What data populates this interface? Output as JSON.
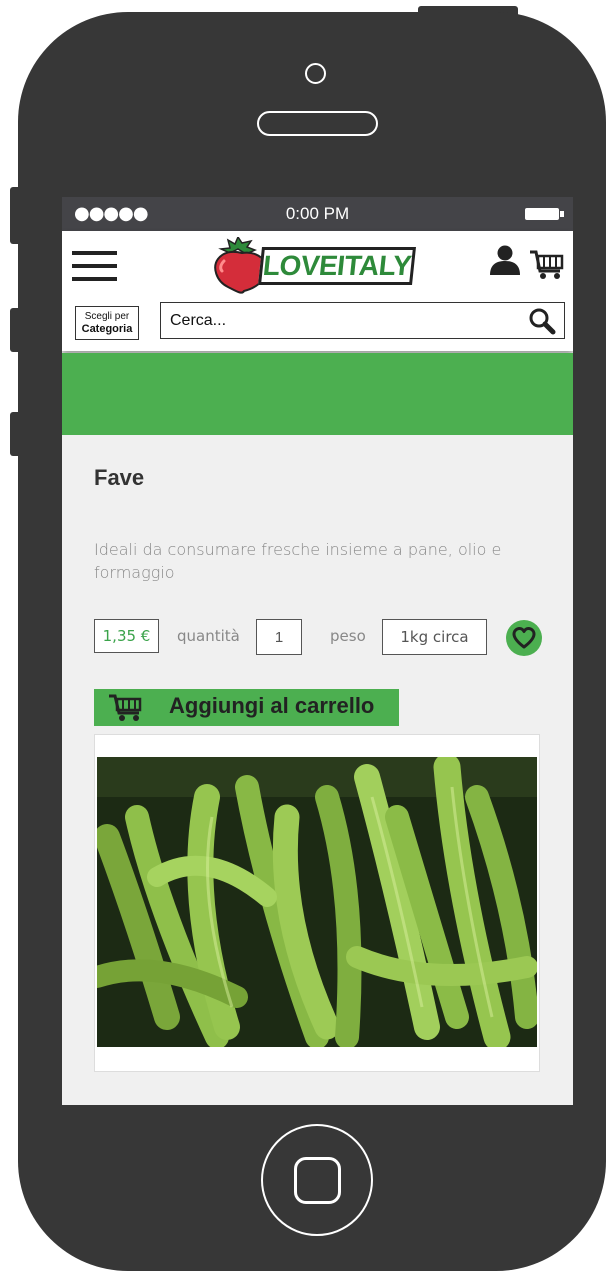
{
  "status_bar": {
    "signal": "●●●●●",
    "time": "0:00 PM"
  },
  "header": {
    "logo_text": "LOVEITALY",
    "category_button": {
      "line1": "Scegli per",
      "line2": "Categoria"
    },
    "search": {
      "placeholder": "Cerca..."
    }
  },
  "product": {
    "title": "Fave",
    "description": "Ideali da consumare fresche insieme a pane, olio e formaggio",
    "price": "1,35 €",
    "quantity_label": "quantità",
    "quantity_value": "1",
    "weight_label": "peso",
    "weight_value": "1kg circa",
    "add_to_cart_label": "Aggiungi al carrello"
  },
  "colors": {
    "accent_green": "#4caf50",
    "phone_body": "#373737"
  }
}
